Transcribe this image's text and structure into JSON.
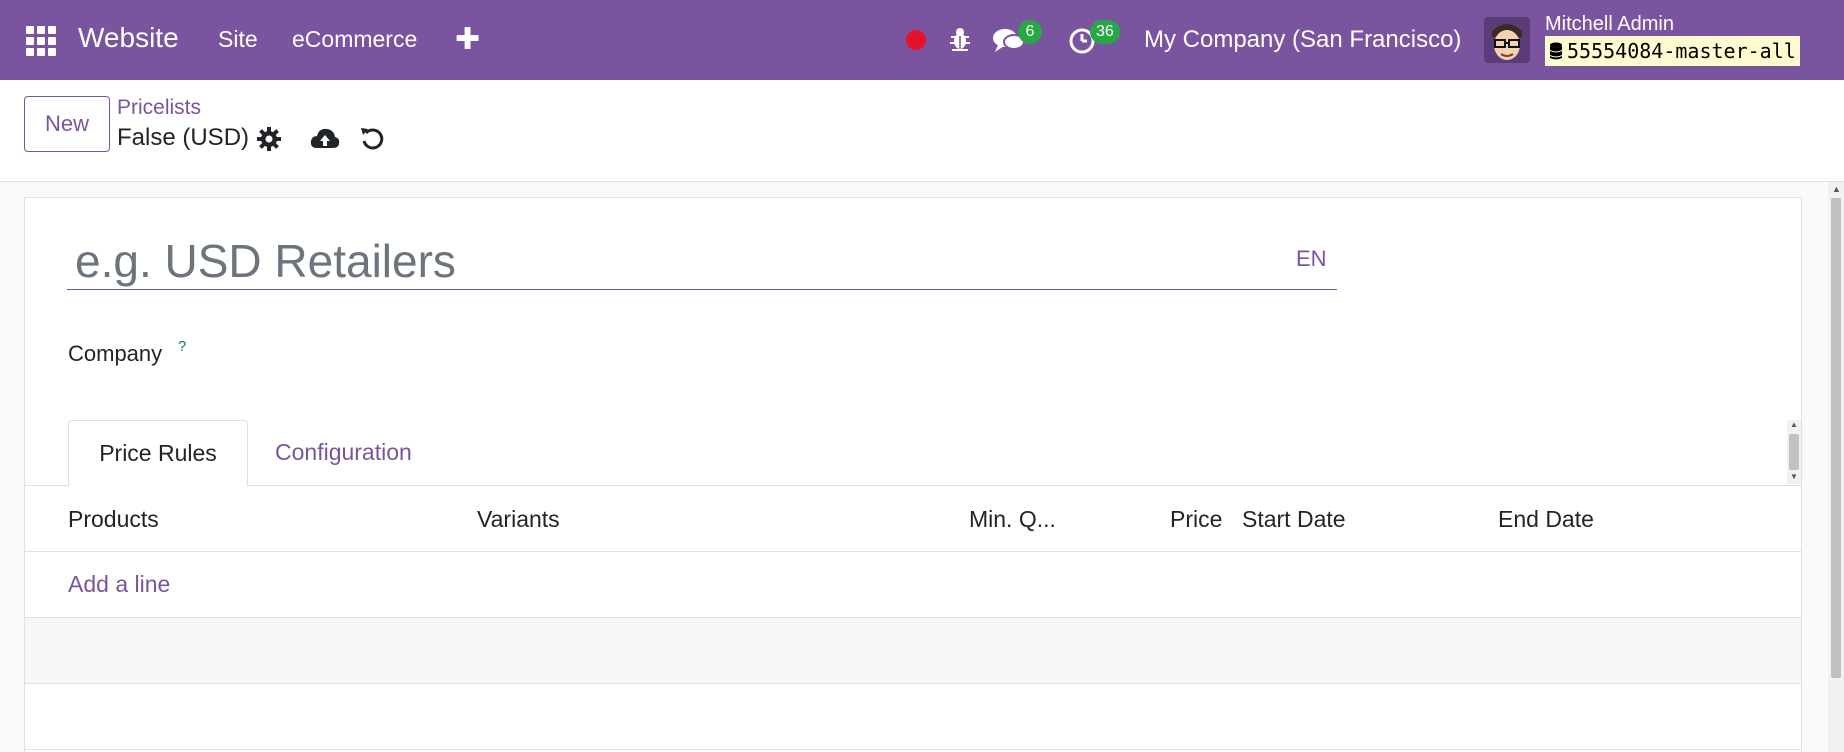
{
  "navbar": {
    "brand": "Website",
    "links": [
      "Site",
      "eCommerce"
    ],
    "add_icon": "plus-icon",
    "messages_count": "6",
    "activities_count": "36",
    "company": "My Company (San Francisco)",
    "user_name": "Mitchell Admin",
    "database": "55554084-master-all",
    "accent_color": "#7b549f",
    "record_color": "#e8112d",
    "badge_color": "#28a745"
  },
  "control_panel": {
    "new_label": "New",
    "breadcrumb": "Pricelists",
    "record_title": "False (USD)",
    "icons": [
      "gear-icon",
      "cloud-upload-icon",
      "discard-icon"
    ]
  },
  "form": {
    "name_placeholder": "e.g. USD Retailers",
    "name_value": "",
    "lang": "EN",
    "company_label": "Company",
    "help": "?"
  },
  "tabs": [
    {
      "label": "Price Rules",
      "active": true
    },
    {
      "label": "Configuration",
      "active": false
    }
  ],
  "table": {
    "columns": [
      "Products",
      "Variants",
      "Min. Q...",
      "Price",
      "Start Date",
      "End Date"
    ],
    "add_line": "Add a line"
  }
}
